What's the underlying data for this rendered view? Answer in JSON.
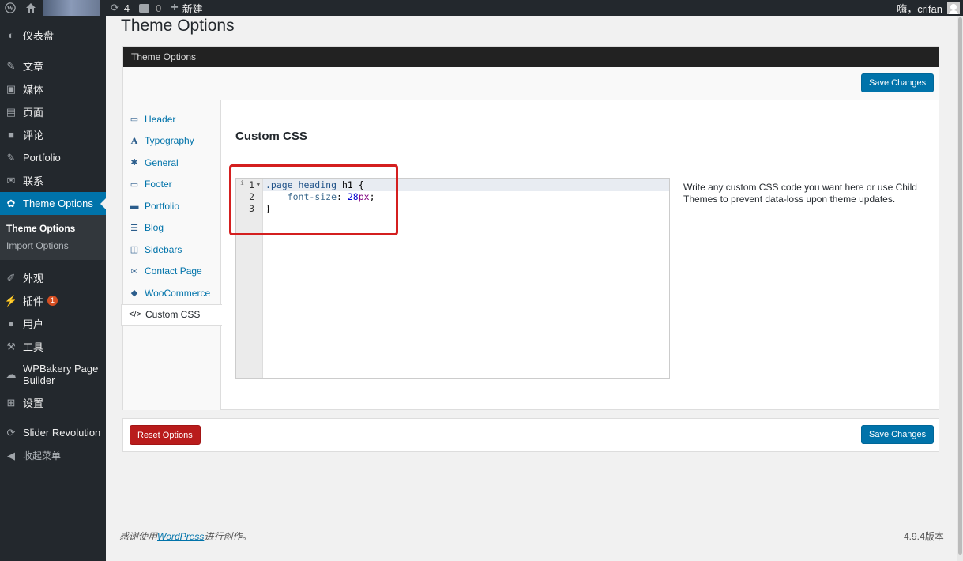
{
  "adminbar": {
    "updates_count": "4",
    "comments_count": "0",
    "new_label": "新建",
    "greeting": "嗨，crifan"
  },
  "sidebar": {
    "items": [
      {
        "label": "仪表盘",
        "icon": "dashboard-icon"
      },
      {
        "label": "文章",
        "icon": "pin-icon"
      },
      {
        "label": "媒体",
        "icon": "media-icon"
      },
      {
        "label": "页面",
        "icon": "page-icon"
      },
      {
        "label": "评论",
        "icon": "comment-icon"
      },
      {
        "label": "Portfolio",
        "icon": "pin-icon"
      },
      {
        "label": "联系",
        "icon": "mail-icon"
      },
      {
        "label": "Theme Options",
        "icon": "gear-icon"
      }
    ],
    "submenu": [
      "Theme Options",
      "Import Options"
    ],
    "items_after": [
      {
        "label": "外观",
        "icon": "brush-icon"
      },
      {
        "label": "插件",
        "icon": "plugin-icon",
        "badge": "1"
      },
      {
        "label": "用户",
        "icon": "user-icon"
      },
      {
        "label": "工具",
        "icon": "wrench-icon"
      },
      {
        "label": "WPBakery Page Builder",
        "icon": "cloud-icon"
      },
      {
        "label": "设置",
        "icon": "settings-icon"
      },
      {
        "label": "Slider Revolution",
        "icon": "refresh-icon"
      },
      {
        "label": "收起菜单",
        "icon": "collapse-icon"
      }
    ]
  },
  "page": {
    "title": "Theme Options",
    "box_header": "Theme Options",
    "save_label": "Save Changes",
    "reset_label": "Reset Options"
  },
  "tabs": [
    {
      "label": "Header",
      "icon": "monitor-icon"
    },
    {
      "label": "Typography",
      "icon": "typography-icon"
    },
    {
      "label": "General",
      "icon": "cog-icon"
    },
    {
      "label": "Footer",
      "icon": "monitor-icon"
    },
    {
      "label": "Portfolio",
      "icon": "briefcase-icon"
    },
    {
      "label": "Blog",
      "icon": "list-icon"
    },
    {
      "label": "Sidebars",
      "icon": "columns-icon"
    },
    {
      "label": "Contact Page",
      "icon": "envelope-icon"
    },
    {
      "label": "WooCommerce",
      "icon": "tag-icon"
    },
    {
      "label": "Custom CSS",
      "icon": "code-icon"
    }
  ],
  "panel": {
    "title": "Custom CSS",
    "description": "Write any custom CSS code you want here or use Child Themes to prevent data-loss upon theme updates.",
    "code": {
      "line_numbers": [
        "1",
        "2",
        "3"
      ],
      "line1_selector": ".page_heading",
      "line1_rest": " h1 {",
      "line2_prop": "font-size",
      "line2_colon": ": ",
      "line2_num": "28",
      "line2_unit": "px",
      "line2_end": ";",
      "line3": "}"
    }
  },
  "footer": {
    "thanks_before": "感谢使用",
    "thanks_link": "WordPress",
    "thanks_after": "进行创作。",
    "version": "4.9.4版本"
  }
}
